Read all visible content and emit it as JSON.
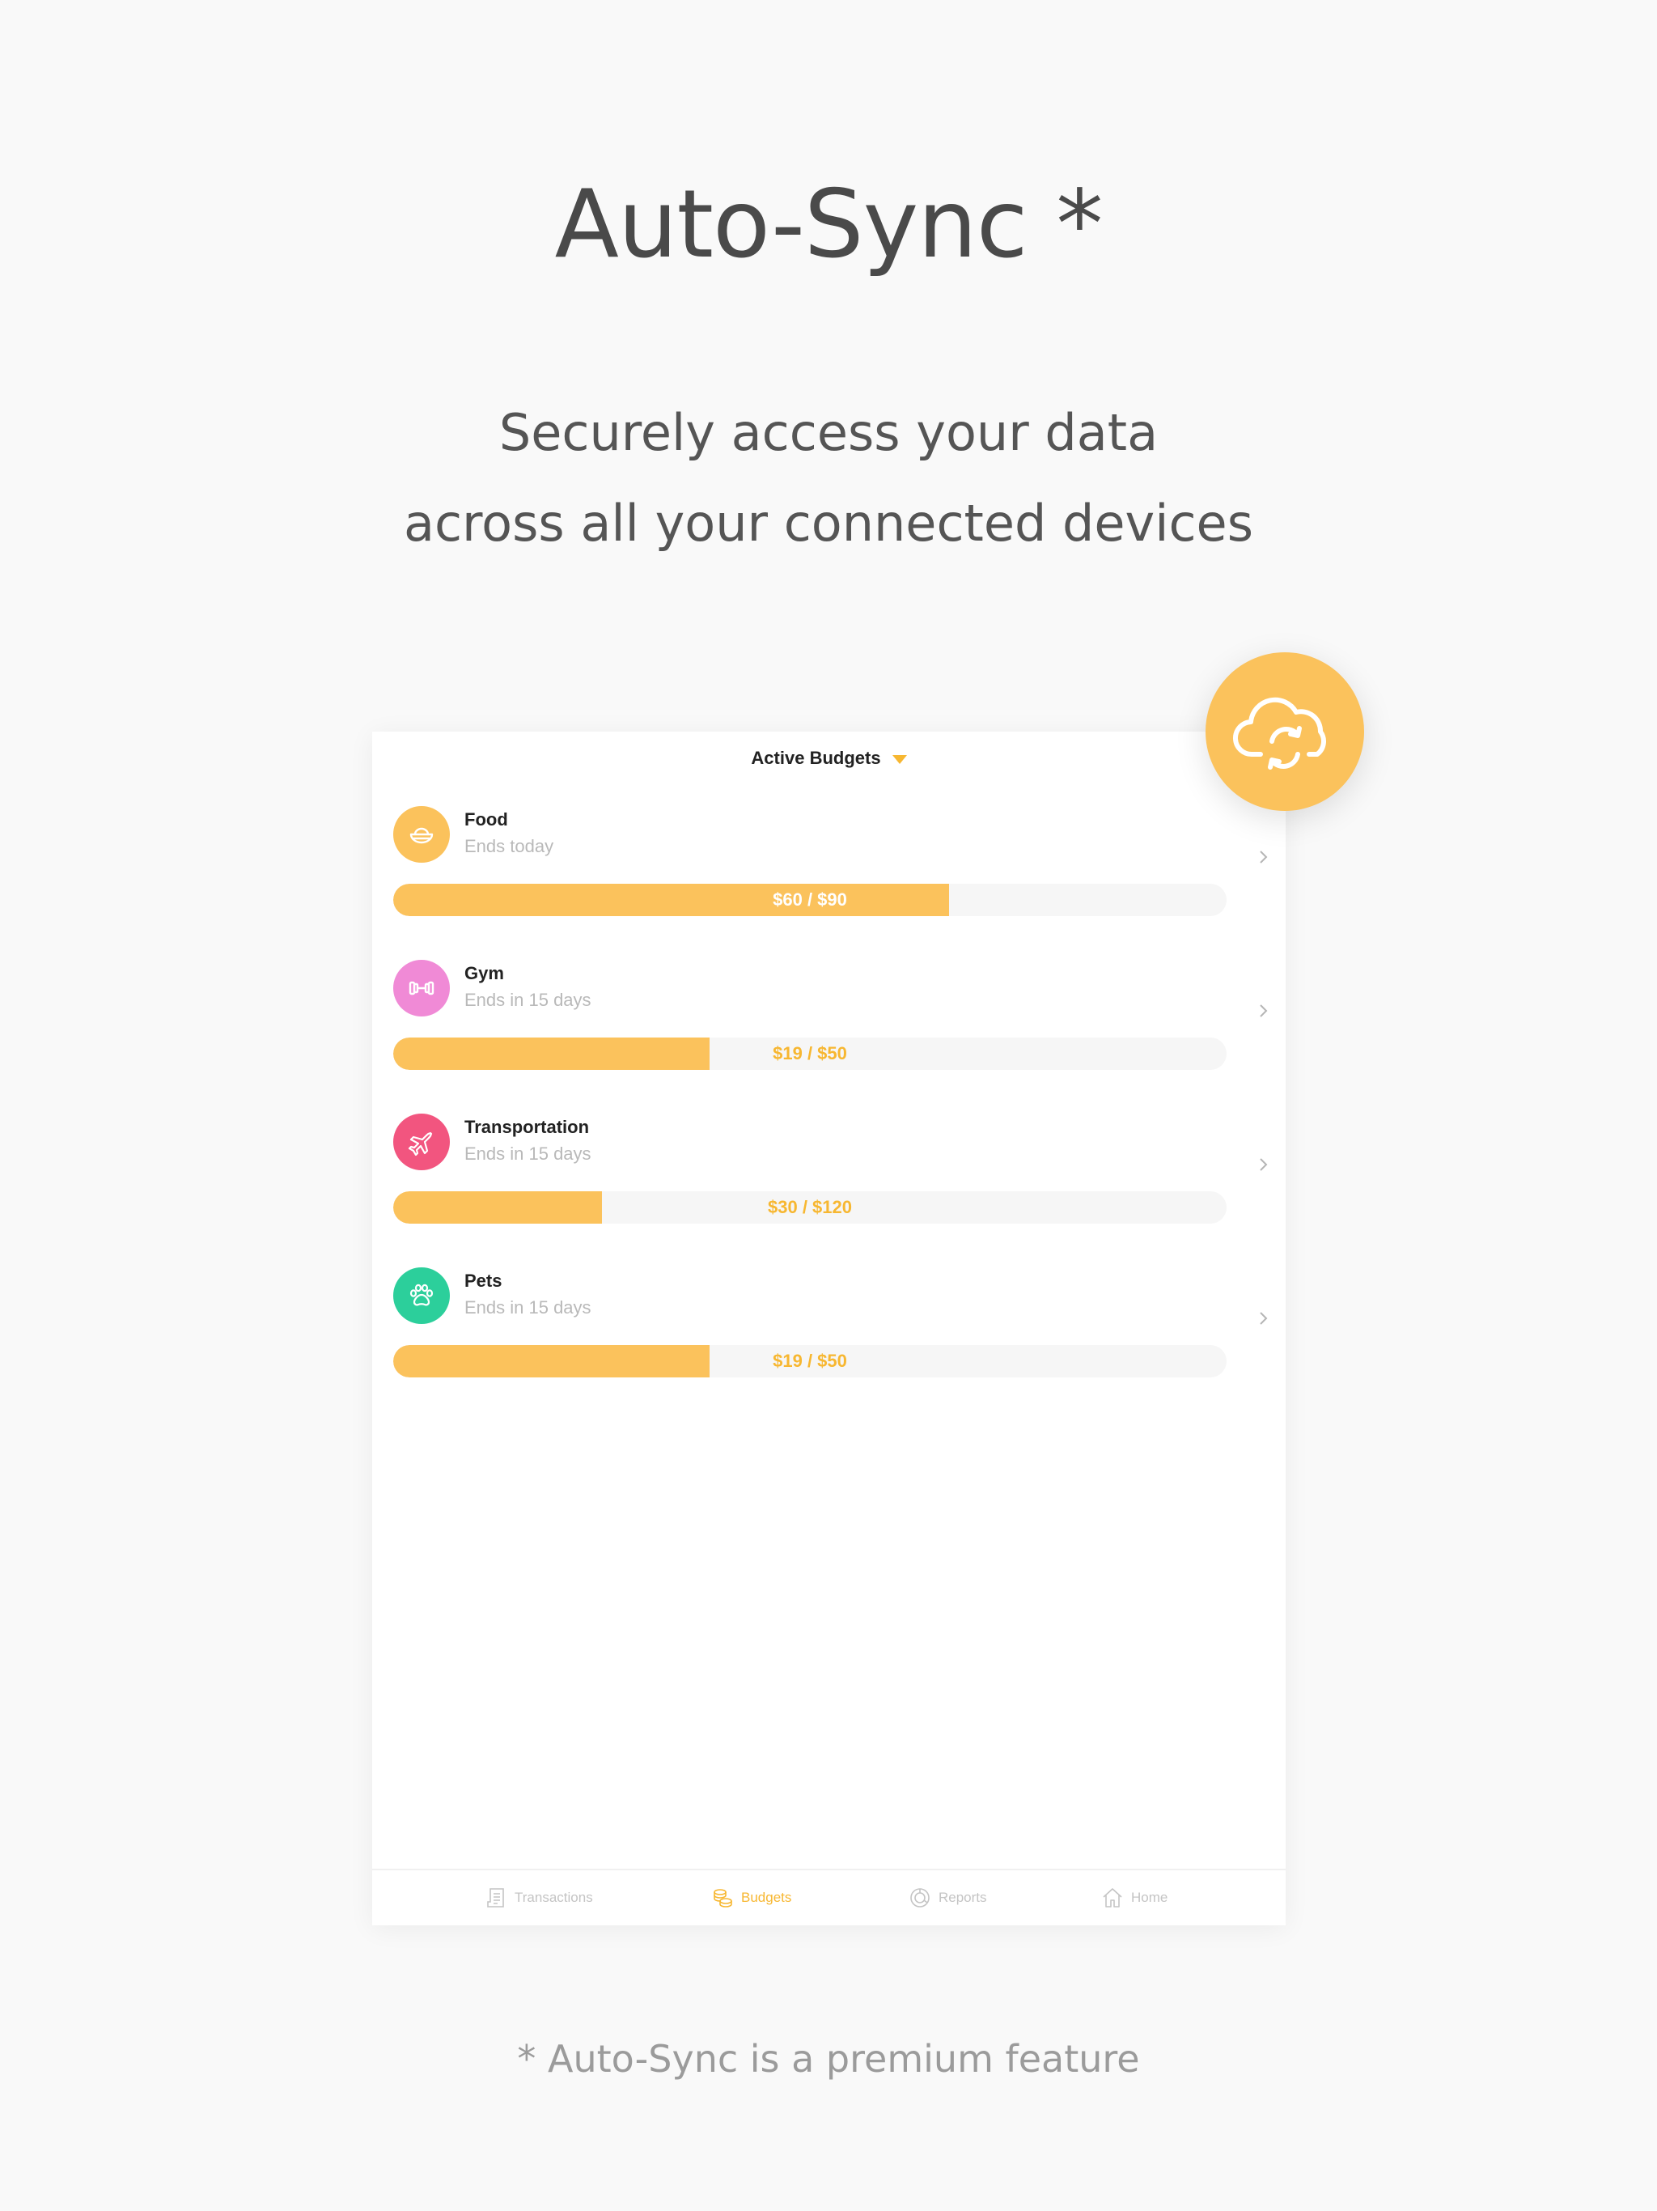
{
  "hero": {
    "title": "Auto-Sync *",
    "subtitle_line1": "Securely access your data",
    "subtitle_line2": "across all your connected devices",
    "footnote": "* Auto-Sync is a premium feature"
  },
  "app": {
    "nav_title": "Active Budgets",
    "budgets": [
      {
        "name": "Food",
        "ends": "Ends today",
        "amount_label": "$60 / $90",
        "progress": 0.667,
        "icon": "food-bowl-icon",
        "color": "#fbc25c"
      },
      {
        "name": "Gym",
        "ends": "Ends in 15 days",
        "amount_label": "$19 / $50",
        "progress": 0.38,
        "icon": "dumbbell-icon",
        "color": "#f08ad6"
      },
      {
        "name": "Transportation",
        "ends": "Ends in 15 days",
        "amount_label": "$30 / $120",
        "progress": 0.25,
        "icon": "airplane-icon",
        "color": "#f2557f"
      },
      {
        "name": "Pets",
        "ends": "Ends in 15 days",
        "amount_label": "$19 / $50",
        "progress": 0.38,
        "icon": "paw-icon",
        "color": "#2ccf9b"
      }
    ],
    "tabs": [
      {
        "label": "Transactions",
        "icon": "receipt-icon",
        "active": false
      },
      {
        "label": "Budgets",
        "icon": "coins-icon",
        "active": true
      },
      {
        "label": "Reports",
        "icon": "donut-chart-icon",
        "active": false
      },
      {
        "label": "Home",
        "icon": "home-icon",
        "active": false
      }
    ]
  },
  "badge": {
    "icon": "cloud-sync-icon"
  },
  "colors": {
    "accent": "#fbc25c",
    "accent_text": "#f7b731",
    "inactive_tab": "#c4c4c4"
  }
}
